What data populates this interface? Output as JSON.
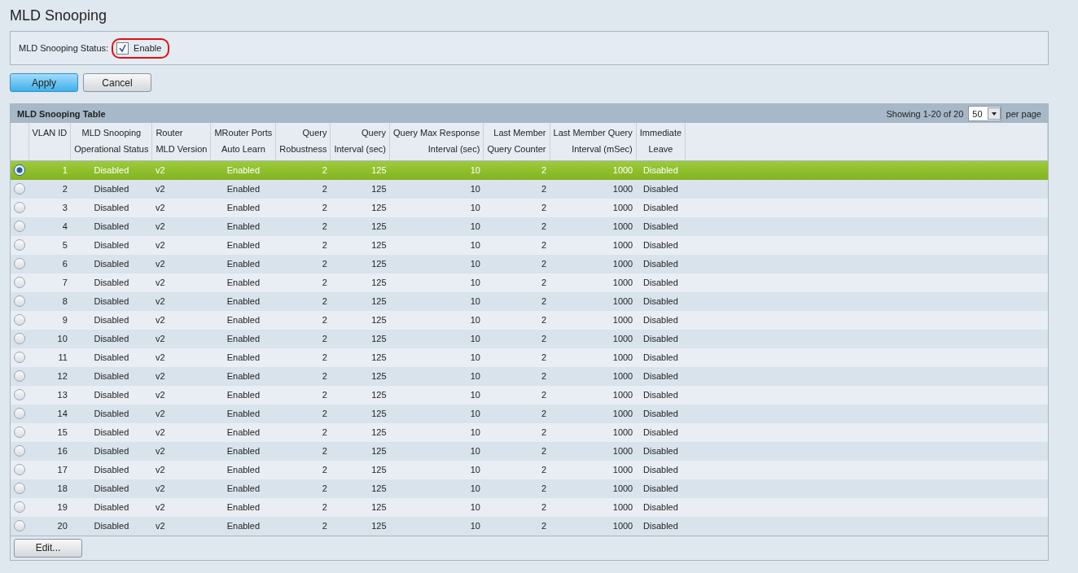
{
  "page_title": "MLD Snooping",
  "status": {
    "label": "MLD Snooping Status:",
    "checked": true,
    "option": "Enable",
    "highlighted": true
  },
  "buttons": [
    {
      "label": "Apply",
      "primary": true
    },
    {
      "label": "Cancel",
      "primary": false
    }
  ],
  "table": {
    "title": "MLD Snooping Table",
    "showing": "Showing 1-20 of 20",
    "page_size": "50",
    "per_page": "per page",
    "columns": [
      "VLAN ID",
      "MLD Snooping\nOperational Status",
      "Router\nMLD Version",
      "MRouter Ports\nAuto Learn",
      "Query\nRobustness",
      "Query\nInterval (sec)",
      "Query Max Response\nInterval (sec)",
      "Last Member\nQuery Counter",
      "Last Member Query\nInterval (mSec)",
      "Immediate\nLeave"
    ],
    "rows": [
      {
        "selected": true,
        "cells": [
          "1",
          "Disabled",
          "v2",
          "Enabled",
          "2",
          "125",
          "10",
          "2",
          "1000",
          "Disabled"
        ]
      },
      {
        "selected": false,
        "cells": [
          "2",
          "Disabled",
          "v2",
          "Enabled",
          "2",
          "125",
          "10",
          "2",
          "1000",
          "Disabled"
        ]
      },
      {
        "selected": false,
        "cells": [
          "3",
          "Disabled",
          "v2",
          "Enabled",
          "2",
          "125",
          "10",
          "2",
          "1000",
          "Disabled"
        ]
      },
      {
        "selected": false,
        "cells": [
          "4",
          "Disabled",
          "v2",
          "Enabled",
          "2",
          "125",
          "10",
          "2",
          "1000",
          "Disabled"
        ]
      },
      {
        "selected": false,
        "cells": [
          "5",
          "Disabled",
          "v2",
          "Enabled",
          "2",
          "125",
          "10",
          "2",
          "1000",
          "Disabled"
        ]
      },
      {
        "selected": false,
        "cells": [
          "6",
          "Disabled",
          "v2",
          "Enabled",
          "2",
          "125",
          "10",
          "2",
          "1000",
          "Disabled"
        ]
      },
      {
        "selected": false,
        "cells": [
          "7",
          "Disabled",
          "v2",
          "Enabled",
          "2",
          "125",
          "10",
          "2",
          "1000",
          "Disabled"
        ]
      },
      {
        "selected": false,
        "cells": [
          "8",
          "Disabled",
          "v2",
          "Enabled",
          "2",
          "125",
          "10",
          "2",
          "1000",
          "Disabled"
        ]
      },
      {
        "selected": false,
        "cells": [
          "9",
          "Disabled",
          "v2",
          "Enabled",
          "2",
          "125",
          "10",
          "2",
          "1000",
          "Disabled"
        ]
      },
      {
        "selected": false,
        "cells": [
          "10",
          "Disabled",
          "v2",
          "Enabled",
          "2",
          "125",
          "10",
          "2",
          "1000",
          "Disabled"
        ]
      },
      {
        "selected": false,
        "cells": [
          "11",
          "Disabled",
          "v2",
          "Enabled",
          "2",
          "125",
          "10",
          "2",
          "1000",
          "Disabled"
        ]
      },
      {
        "selected": false,
        "cells": [
          "12",
          "Disabled",
          "v2",
          "Enabled",
          "2",
          "125",
          "10",
          "2",
          "1000",
          "Disabled"
        ]
      },
      {
        "selected": false,
        "cells": [
          "13",
          "Disabled",
          "v2",
          "Enabled",
          "2",
          "125",
          "10",
          "2",
          "1000",
          "Disabled"
        ]
      },
      {
        "selected": false,
        "cells": [
          "14",
          "Disabled",
          "v2",
          "Enabled",
          "2",
          "125",
          "10",
          "2",
          "1000",
          "Disabled"
        ]
      },
      {
        "selected": false,
        "cells": [
          "15",
          "Disabled",
          "v2",
          "Enabled",
          "2",
          "125",
          "10",
          "2",
          "1000",
          "Disabled"
        ]
      },
      {
        "selected": false,
        "cells": [
          "16",
          "Disabled",
          "v2",
          "Enabled",
          "2",
          "125",
          "10",
          "2",
          "1000",
          "Disabled"
        ]
      },
      {
        "selected": false,
        "cells": [
          "17",
          "Disabled",
          "v2",
          "Enabled",
          "2",
          "125",
          "10",
          "2",
          "1000",
          "Disabled"
        ]
      },
      {
        "selected": false,
        "cells": [
          "18",
          "Disabled",
          "v2",
          "Enabled",
          "2",
          "125",
          "10",
          "2",
          "1000",
          "Disabled"
        ]
      },
      {
        "selected": false,
        "cells": [
          "19",
          "Disabled",
          "v2",
          "Enabled",
          "2",
          "125",
          "10",
          "2",
          "1000",
          "Disabled"
        ]
      },
      {
        "selected": false,
        "cells": [
          "20",
          "Disabled",
          "v2",
          "Enabled",
          "2",
          "125",
          "10",
          "2",
          "1000",
          "Disabled"
        ]
      }
    ],
    "footer_button": "Edit..."
  }
}
